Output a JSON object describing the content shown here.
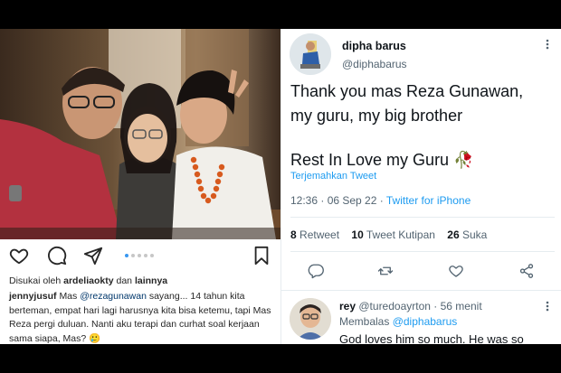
{
  "instagram": {
    "carousel_dots": 5,
    "active_dot": 0,
    "liked_by_prefix": "Disukai oleh",
    "liked_by_user": "ardeliaokty",
    "liked_by_and": "dan",
    "liked_by_others": "lainnya",
    "caption_user": "jennyjusuf",
    "caption_pre": "Mas",
    "caption_mention": "@rezagunawan",
    "caption_post": "sayang... 14 tahun kita berteman, empat hari lagi harusnya kita bisa ketemu, tapi Mas Reza pergi duluan. Nanti aku terapi dan curhat soal kerjaan sama siapa, Mas? 🥲"
  },
  "tweet": {
    "name": "dipha barus",
    "handle": "@diphabarus",
    "text_line1": "Thank you mas Reza Gunawan,",
    "text_line2": "my guru, my big brother",
    "text_line3": "Rest In Love my Guru 🥀",
    "translate": "Terjemahkan Tweet",
    "time": "12:36 · 06 Sep 22 ·",
    "source": "Twitter for iPhone",
    "retweets_count": "8",
    "retweets_label": "Retweet",
    "quotes_count": "10",
    "quotes_label": "Tweet Kutipan",
    "likes_count": "26",
    "likes_label": "Suka"
  },
  "reply": {
    "name": "rey",
    "handle": "@turedoayrton",
    "sep": "·",
    "time": "56 menit",
    "replying_label": "Membalas",
    "replying_to": "@diphabarus",
    "text": "God loves him so much. He was so"
  },
  "colors": {
    "twitter_blue": "#1d9bf0",
    "ig_blue": "#3897f0",
    "text_dark": "#0f1419",
    "text_grey": "#536471"
  }
}
